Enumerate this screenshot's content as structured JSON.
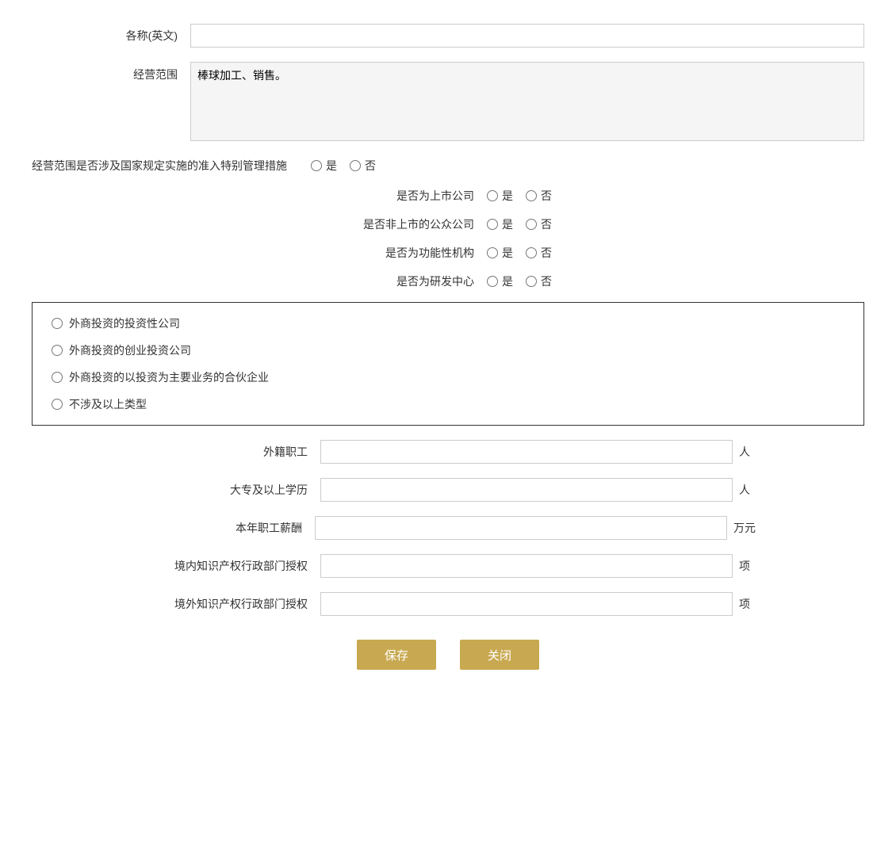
{
  "form": {
    "name_en_label": "各称(英文)",
    "name_en_value": "",
    "business_scope_label": "经营范围",
    "business_scope_value": "棒球加工、销售。",
    "special_management_label": "经营范围是否涉及国家规定实施的准入特别管理措施",
    "special_management_yes": "是",
    "special_management_no": "否",
    "listed_company_label": "是否为上市公司",
    "listed_yes": "是",
    "listed_no": "否",
    "non_listed_public_label": "是否非上市的公众公司",
    "non_listed_yes": "是",
    "non_listed_no": "否",
    "functional_org_label": "是否为功能性机构",
    "functional_yes": "是",
    "functional_no": "否",
    "rd_center_label": "是否为研发中心",
    "rd_yes": "是",
    "rd_no": "否",
    "investment_company_label": "外商投资的投资性公司",
    "venture_capital_label": "外商投资的创业投资公司",
    "partnership_label": "外商投资的以投资为主要业务的合伙企业",
    "not_applicable_label": "不涉及以上类型",
    "foreign_staff_label": "外籍职工",
    "foreign_staff_unit": "人",
    "foreign_staff_value": "",
    "college_above_label": "大专及以上学历",
    "college_above_unit": "人",
    "college_above_value": "",
    "annual_salary_label": "本年职工薪酬",
    "annual_salary_unit": "万元",
    "annual_salary_value": "",
    "domestic_ip_label": "境内知识产权行政部门授权",
    "domestic_ip_unit": "项",
    "domestic_ip_value": "",
    "foreign_ip_label": "境外知识产权行政部门授权",
    "foreign_ip_unit": "项",
    "foreign_ip_value": "",
    "save_button": "保存",
    "close_button": "关闭"
  }
}
